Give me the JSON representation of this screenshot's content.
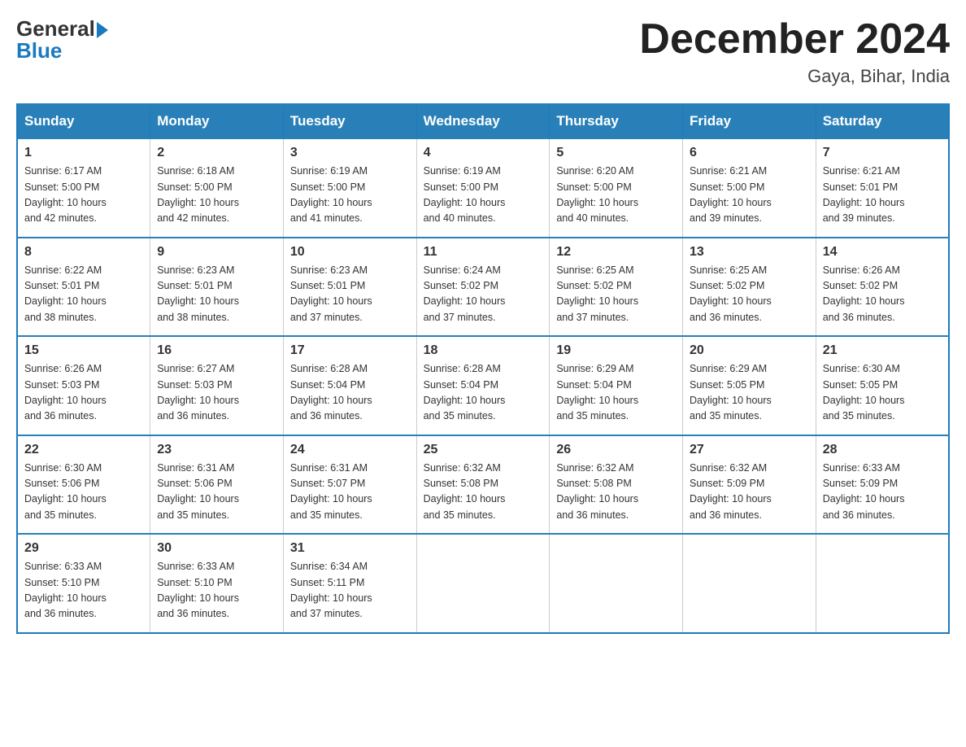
{
  "logo": {
    "general": "General",
    "blue": "Blue"
  },
  "header": {
    "month": "December 2024",
    "location": "Gaya, Bihar, India"
  },
  "weekdays": [
    "Sunday",
    "Monday",
    "Tuesday",
    "Wednesday",
    "Thursday",
    "Friday",
    "Saturday"
  ],
  "weeks": [
    [
      {
        "day": "1",
        "sunrise": "6:17 AM",
        "sunset": "5:00 PM",
        "daylight": "10 hours and 42 minutes."
      },
      {
        "day": "2",
        "sunrise": "6:18 AM",
        "sunset": "5:00 PM",
        "daylight": "10 hours and 42 minutes."
      },
      {
        "day": "3",
        "sunrise": "6:19 AM",
        "sunset": "5:00 PM",
        "daylight": "10 hours and 41 minutes."
      },
      {
        "day": "4",
        "sunrise": "6:19 AM",
        "sunset": "5:00 PM",
        "daylight": "10 hours and 40 minutes."
      },
      {
        "day": "5",
        "sunrise": "6:20 AM",
        "sunset": "5:00 PM",
        "daylight": "10 hours and 40 minutes."
      },
      {
        "day": "6",
        "sunrise": "6:21 AM",
        "sunset": "5:00 PM",
        "daylight": "10 hours and 39 minutes."
      },
      {
        "day": "7",
        "sunrise": "6:21 AM",
        "sunset": "5:01 PM",
        "daylight": "10 hours and 39 minutes."
      }
    ],
    [
      {
        "day": "8",
        "sunrise": "6:22 AM",
        "sunset": "5:01 PM",
        "daylight": "10 hours and 38 minutes."
      },
      {
        "day": "9",
        "sunrise": "6:23 AM",
        "sunset": "5:01 PM",
        "daylight": "10 hours and 38 minutes."
      },
      {
        "day": "10",
        "sunrise": "6:23 AM",
        "sunset": "5:01 PM",
        "daylight": "10 hours and 37 minutes."
      },
      {
        "day": "11",
        "sunrise": "6:24 AM",
        "sunset": "5:02 PM",
        "daylight": "10 hours and 37 minutes."
      },
      {
        "day": "12",
        "sunrise": "6:25 AM",
        "sunset": "5:02 PM",
        "daylight": "10 hours and 37 minutes."
      },
      {
        "day": "13",
        "sunrise": "6:25 AM",
        "sunset": "5:02 PM",
        "daylight": "10 hours and 36 minutes."
      },
      {
        "day": "14",
        "sunrise": "6:26 AM",
        "sunset": "5:02 PM",
        "daylight": "10 hours and 36 minutes."
      }
    ],
    [
      {
        "day": "15",
        "sunrise": "6:26 AM",
        "sunset": "5:03 PM",
        "daylight": "10 hours and 36 minutes."
      },
      {
        "day": "16",
        "sunrise": "6:27 AM",
        "sunset": "5:03 PM",
        "daylight": "10 hours and 36 minutes."
      },
      {
        "day": "17",
        "sunrise": "6:28 AM",
        "sunset": "5:04 PM",
        "daylight": "10 hours and 36 minutes."
      },
      {
        "day": "18",
        "sunrise": "6:28 AM",
        "sunset": "5:04 PM",
        "daylight": "10 hours and 35 minutes."
      },
      {
        "day": "19",
        "sunrise": "6:29 AM",
        "sunset": "5:04 PM",
        "daylight": "10 hours and 35 minutes."
      },
      {
        "day": "20",
        "sunrise": "6:29 AM",
        "sunset": "5:05 PM",
        "daylight": "10 hours and 35 minutes."
      },
      {
        "day": "21",
        "sunrise": "6:30 AM",
        "sunset": "5:05 PM",
        "daylight": "10 hours and 35 minutes."
      }
    ],
    [
      {
        "day": "22",
        "sunrise": "6:30 AM",
        "sunset": "5:06 PM",
        "daylight": "10 hours and 35 minutes."
      },
      {
        "day": "23",
        "sunrise": "6:31 AM",
        "sunset": "5:06 PM",
        "daylight": "10 hours and 35 minutes."
      },
      {
        "day": "24",
        "sunrise": "6:31 AM",
        "sunset": "5:07 PM",
        "daylight": "10 hours and 35 minutes."
      },
      {
        "day": "25",
        "sunrise": "6:32 AM",
        "sunset": "5:08 PM",
        "daylight": "10 hours and 35 minutes."
      },
      {
        "day": "26",
        "sunrise": "6:32 AM",
        "sunset": "5:08 PM",
        "daylight": "10 hours and 36 minutes."
      },
      {
        "day": "27",
        "sunrise": "6:32 AM",
        "sunset": "5:09 PM",
        "daylight": "10 hours and 36 minutes."
      },
      {
        "day": "28",
        "sunrise": "6:33 AM",
        "sunset": "5:09 PM",
        "daylight": "10 hours and 36 minutes."
      }
    ],
    [
      {
        "day": "29",
        "sunrise": "6:33 AM",
        "sunset": "5:10 PM",
        "daylight": "10 hours and 36 minutes."
      },
      {
        "day": "30",
        "sunrise": "6:33 AM",
        "sunset": "5:10 PM",
        "daylight": "10 hours and 36 minutes."
      },
      {
        "day": "31",
        "sunrise": "6:34 AM",
        "sunset": "5:11 PM",
        "daylight": "10 hours and 37 minutes."
      },
      null,
      null,
      null,
      null
    ]
  ],
  "labels": {
    "sunrise_prefix": "Sunrise: ",
    "sunset_prefix": "Sunset: ",
    "daylight_prefix": "Daylight: "
  }
}
